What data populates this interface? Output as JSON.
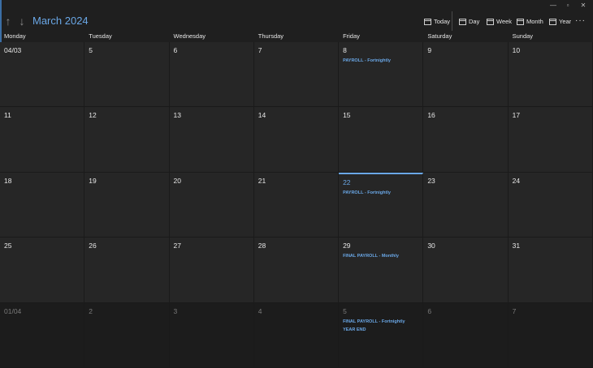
{
  "window": {
    "minimize": "—",
    "restore": "▫",
    "close": "✕"
  },
  "header": {
    "title": "March 2024",
    "up_arrow": "↑",
    "down_arrow": "↓",
    "toolbar": {
      "today_label": "Today",
      "day_label": "Day",
      "week_label": "Week",
      "month_label": "Month",
      "year_label": "Year",
      "more_label": "···"
    }
  },
  "weekdays": [
    "Monday",
    "Tuesday",
    "Wednesday",
    "Thursday",
    "Friday",
    "Saturday",
    "Sunday"
  ],
  "weeks": [
    [
      {
        "label": "04/03",
        "events": []
      },
      {
        "label": "5",
        "events": []
      },
      {
        "label": "6",
        "events": []
      },
      {
        "label": "7",
        "events": []
      },
      {
        "label": "8",
        "events": [
          "PAYROLL - Fortnightly"
        ]
      },
      {
        "label": "9",
        "events": []
      },
      {
        "label": "10",
        "events": []
      }
    ],
    [
      {
        "label": "11",
        "events": []
      },
      {
        "label": "12",
        "events": []
      },
      {
        "label": "13",
        "events": []
      },
      {
        "label": "14",
        "events": []
      },
      {
        "label": "15",
        "events": []
      },
      {
        "label": "16",
        "events": []
      },
      {
        "label": "17",
        "events": []
      }
    ],
    [
      {
        "label": "18",
        "events": []
      },
      {
        "label": "19",
        "events": []
      },
      {
        "label": "20",
        "events": []
      },
      {
        "label": "21",
        "events": []
      },
      {
        "label": "22",
        "events": [
          "PAYROLL - Fortnightly"
        ],
        "today": true
      },
      {
        "label": "23",
        "events": []
      },
      {
        "label": "24",
        "events": []
      }
    ],
    [
      {
        "label": "25",
        "events": []
      },
      {
        "label": "26",
        "events": []
      },
      {
        "label": "27",
        "events": []
      },
      {
        "label": "28",
        "events": []
      },
      {
        "label": "29",
        "events": [
          "FINAL PAYROLL - Monthly"
        ]
      },
      {
        "label": "30",
        "events": []
      },
      {
        "label": "31",
        "events": []
      }
    ],
    [
      {
        "label": "01/04",
        "events": [],
        "other_month": true
      },
      {
        "label": "2",
        "events": [],
        "other_month": true
      },
      {
        "label": "3",
        "events": [],
        "other_month": true
      },
      {
        "label": "4",
        "events": [],
        "other_month": true
      },
      {
        "label": "5",
        "events": [
          "FINAL PAYROLL - Fortnightly",
          "YEAR END"
        ],
        "other_month": true
      },
      {
        "label": "6",
        "events": [],
        "other_month": true
      },
      {
        "label": "7",
        "events": [],
        "other_month": true
      }
    ]
  ],
  "colors": {
    "accent": "#6aa7e6",
    "background": "#1f1f1f",
    "cell": "#262626",
    "other_month_cell": "#1c1c1c"
  }
}
